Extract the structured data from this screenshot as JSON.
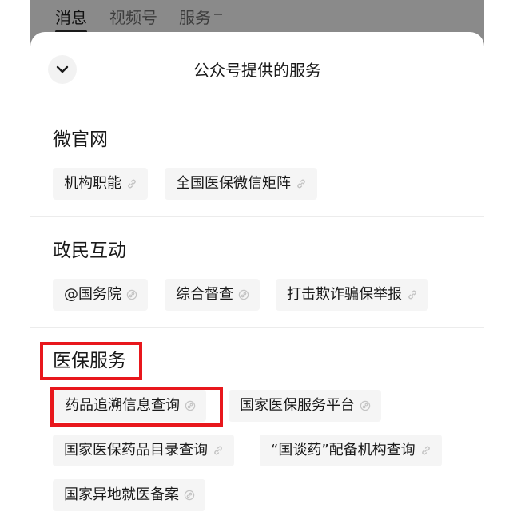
{
  "background_tabs": [
    "消息",
    "视频号",
    "服务"
  ],
  "sheet": {
    "title": "公众号提供的服务"
  },
  "sections": [
    {
      "title": "微官网",
      "items": [
        "机构职能",
        "全国医保微信矩阵"
      ]
    },
    {
      "title": "政民互动",
      "items": [
        "@国务院",
        "综合督查",
        "打击欺诈骗保举报"
      ]
    },
    {
      "title": "医保服务",
      "items": [
        "药品追溯信息查询",
        "国家医保服务平台",
        "国家医保药品目录查询",
        "“国谈药”配备机构查询",
        "国家异地就医备案"
      ]
    }
  ],
  "colors": {
    "highlight": "#e8171c",
    "chip_background": "#f5f5f5",
    "overlay": "#8a8a8a"
  },
  "icons": {
    "collapse": "chevron-down-icon",
    "item_link": "link-icon"
  }
}
